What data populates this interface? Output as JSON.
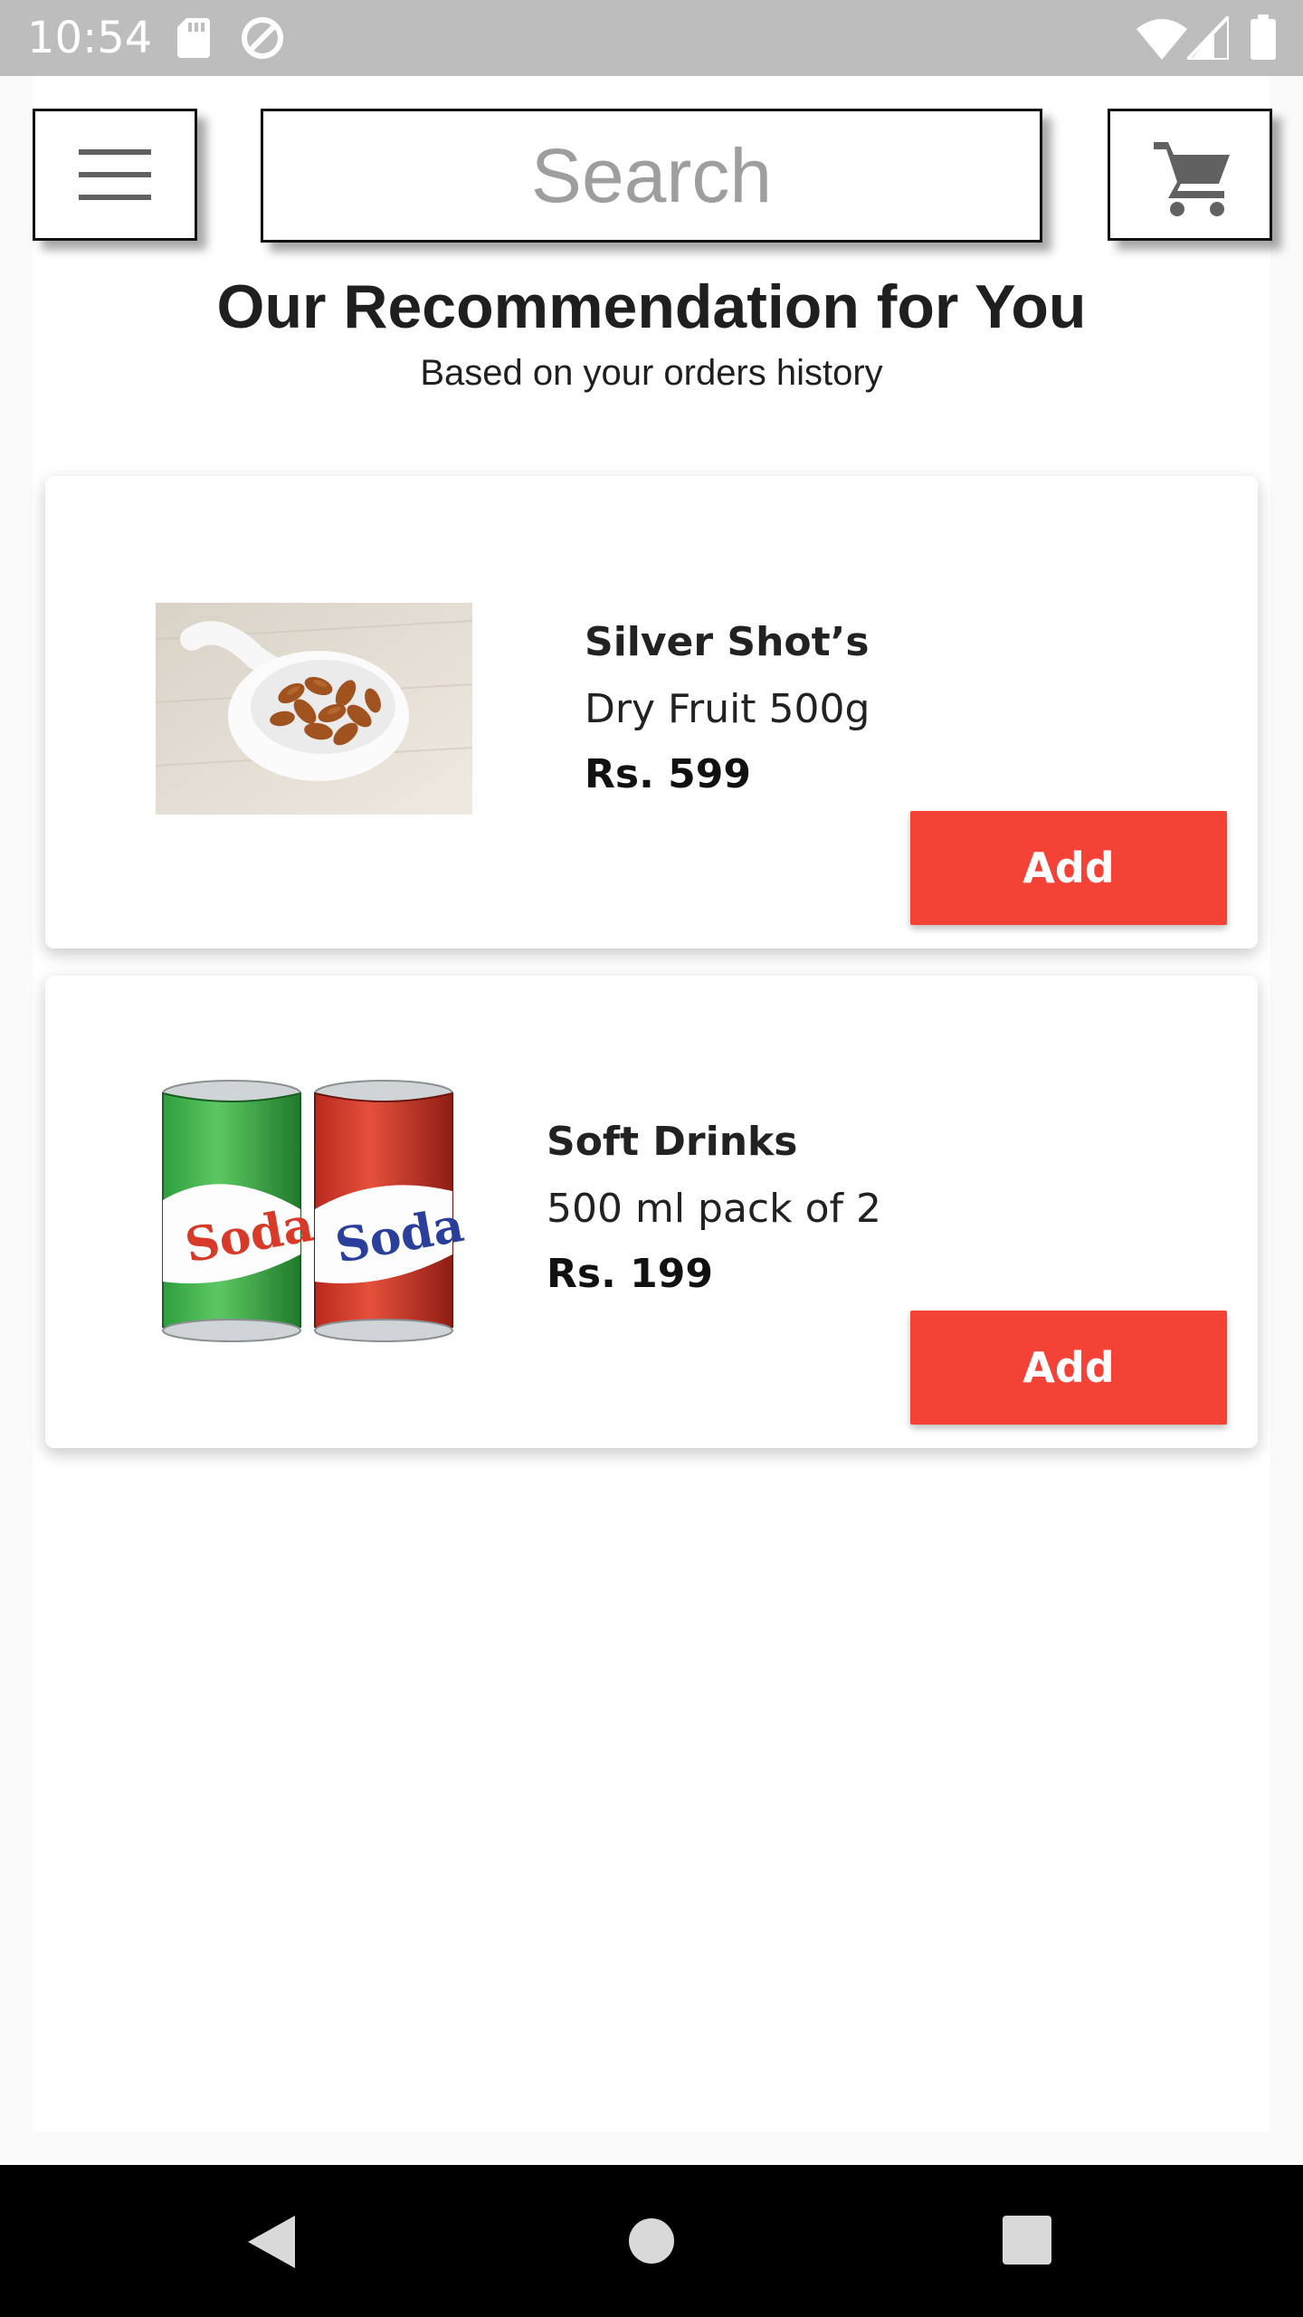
{
  "status_bar": {
    "time": "10:54",
    "icons": [
      "sd-card-icon",
      "sync-icon",
      "wifi-icon",
      "signal-icon",
      "battery-icon"
    ]
  },
  "header": {
    "menu_icon": "hamburger-menu-icon",
    "search_placeholder": "Search",
    "cart_icon": "shopping-cart-icon"
  },
  "section": {
    "title": "Our Recommendation for You",
    "subtitle": "Based on your orders history"
  },
  "products": [
    {
      "name": "Silver Shot’s",
      "description": "Dry Fruit 500g",
      "price": "Rs. 599",
      "add_label": "Add",
      "image_icon": "almonds-image"
    },
    {
      "name": "Soft Drinks",
      "description": "500 ml pack of 2",
      "price": "Rs. 199",
      "add_label": "Add",
      "image_icon": "soda-cans-image"
    }
  ],
  "colors": {
    "accent": "#f44336",
    "status_bar": "#bdbdbd",
    "nav_bar": "#000000"
  },
  "navigation": {
    "icons": [
      "back-icon",
      "home-icon",
      "recents-icon"
    ]
  }
}
